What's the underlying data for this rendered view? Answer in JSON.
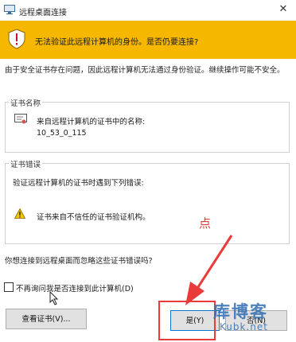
{
  "window": {
    "title": "远程桌面连接",
    "close_label": "✕"
  },
  "banner": {
    "text": "无法验证此远程计算机的身份。是否仍要连接?",
    "color": "#f5b700"
  },
  "description": "由于安全证书存在问题，因此远程计算机无法通过身份验证。继续操作可能不安全。",
  "cert_group": {
    "title": "证书名称",
    "name_label": "来自远程计算机的证书中的名称:",
    "name_value": "10_53_0_115"
  },
  "error_group": {
    "title": "证书错误",
    "intro": "验证远程计算机的证书时遇到下列错误:",
    "items": [
      "证书来自不信任的证书验证机构。"
    ]
  },
  "question": "你想连接到远程桌面而忽略这些证书错误吗?",
  "checkbox": {
    "label": "不再询问我是否连接到此计算机(D)",
    "checked": false
  },
  "buttons": {
    "view_cert": "查看证书(V)...",
    "yes": "是(Y)",
    "no": "否(N)"
  },
  "annotation": {
    "text": "点",
    "color": "#ea3b3b"
  },
  "watermark": {
    "title": "库博客",
    "url": "Kubk.net"
  }
}
